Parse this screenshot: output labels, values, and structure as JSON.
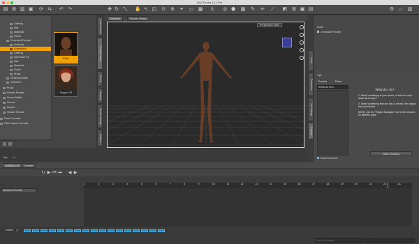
{
  "window": {
    "title": "DAZ Studio 4.12 Pro"
  },
  "colors": {
    "accent": "#f2a100",
    "viewport_bg": "#2a2a2a",
    "panel_bg": "#4b4b4b",
    "chip_blue": "#1f7fb0"
  },
  "toolbar": {
    "icons": [
      "files-icon",
      "open-icon",
      "save-icon",
      "undo-icon",
      "redo-icon",
      "move-icon",
      "rotate-icon",
      "scale-icon",
      "pose-icon",
      "select-icon",
      "render-icon",
      "render-settings-icon",
      "camera-icon",
      "grid-icon",
      "settings-icon",
      "home-icon"
    ]
  },
  "left_tree": {
    "items": [
      {
        "label": "Clothing"
      },
      {
        "label": "Hair"
      },
      {
        "label": "Materials"
      },
      {
        "label": "Poses"
      },
      {
        "label": "Genesis 8 Female"
      },
      {
        "label": "Anatomy"
      },
      {
        "label": "Characters"
      },
      {
        "label": "Clothing"
      },
      {
        "label": "Developer Kit"
      },
      {
        "label": "Hair"
      },
      {
        "label": "Materials"
      },
      {
        "label": "Poses"
      },
      {
        "label": "Props"
      },
      {
        "label": "Genesis 8 Male"
      },
      {
        "label": "Victoria 8"
      },
      {
        "label": "Props"
      },
      {
        "label": "Render Presets"
      },
      {
        "label": "Scene Builder"
      },
      {
        "label": "Scenes"
      },
      {
        "label": "Scripts"
      },
      {
        "label": "Shader Presets"
      },
      {
        "label": "Poser Formats"
      },
      {
        "label": "Other Import Formats"
      }
    ]
  },
  "thumbs": {
    "items": [
      {
        "label": "Eden"
      },
      {
        "label": "Pepper G8"
      }
    ]
  },
  "left_vtabs": [
    "Smart Content",
    "Content Library",
    "Posing",
    "Shaping",
    "Render Settings",
    "Surfaces"
  ],
  "viewport": {
    "tabs": [
      "Viewport",
      "Render Library"
    ],
    "view_label": "Perspective View"
  },
  "scene": {
    "header": "Node",
    "rows": [
      "Genesis 8 Female"
    ]
  },
  "right_tabs": {
    "top": [
      "Tips",
      "Presets",
      "Editor"
    ],
    "select_label": "Select an Item..."
  },
  "help": {
    "title": "What do I do?",
    "step1": "1. Select something in your scene, or from the drop-down list at top of",
    "step2": "2. Select something from the list on the left, then adjust the controls that",
    "note": "NOTE: Use the \"Region Navigator\" tool to find morphs for different parts",
    "video_button": "Video: Shaping",
    "show_sub_items": "Show Sub Items"
  },
  "right_vtabs": [
    "Scene",
    "Parameters",
    "Tool Settings",
    "Shaping"
  ],
  "timeline": {
    "tabs": [
      "aniMate Lite",
      "Timeline"
    ],
    "ruler_ticks": [
      "1",
      "2",
      "3",
      "4",
      "5",
      "6",
      "7",
      "8",
      "9",
      "10",
      "11",
      "12",
      "13",
      "14",
      "15",
      "16",
      "17",
      "18",
      "19",
      "20",
      "21",
      "22",
      "23"
    ],
    "track_label": "Genesis 8 Female",
    "dance_label": "Dance",
    "lesson_placeholder": "Select a Lesson..."
  },
  "bottom_tabs": {
    "tips": "Tips",
    "lo": "Lo"
  }
}
